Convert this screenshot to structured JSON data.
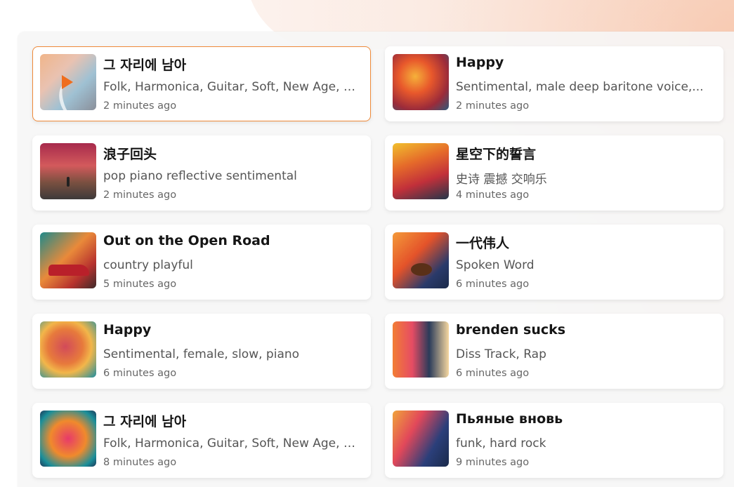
{
  "colors": {
    "accent": "#ef8a3a",
    "play": "#ef6d1d"
  },
  "tracks": [
    {
      "title": "그 자리에 남아",
      "tags": "Folk, Harmonica, Guitar, Soft, New Age, N...",
      "time": "2 minutes ago",
      "selected": true
    },
    {
      "title": "Happy",
      "tags": "Sentimental, male deep baritone voice,...",
      "time": "2 minutes ago"
    },
    {
      "title": "浪子回头",
      "tags": "pop piano reflective sentimental",
      "time": "2 minutes ago"
    },
    {
      "title": "星空下的誓言",
      "tags": "史诗 震撼 交响乐",
      "time": "4 minutes ago"
    },
    {
      "title": "Out on the Open Road",
      "tags": "country playful",
      "time": "5 minutes ago"
    },
    {
      "title": "一代伟人",
      "tags": "Spoken Word",
      "time": "6 minutes ago"
    },
    {
      "title": "Happy",
      "tags": "Sentimental, female, slow, piano",
      "time": "6 minutes ago"
    },
    {
      "title": "brenden sucks",
      "tags": "Diss Track, Rap",
      "time": "6 minutes ago"
    },
    {
      "title": "그 자리에 남아",
      "tags": "Folk, Harmonica, Guitar, Soft, New Age, N...",
      "time": "8 minutes ago"
    },
    {
      "title": "Пьяные вновь",
      "tags": "funk, hard rock",
      "time": "9 minutes ago"
    }
  ]
}
